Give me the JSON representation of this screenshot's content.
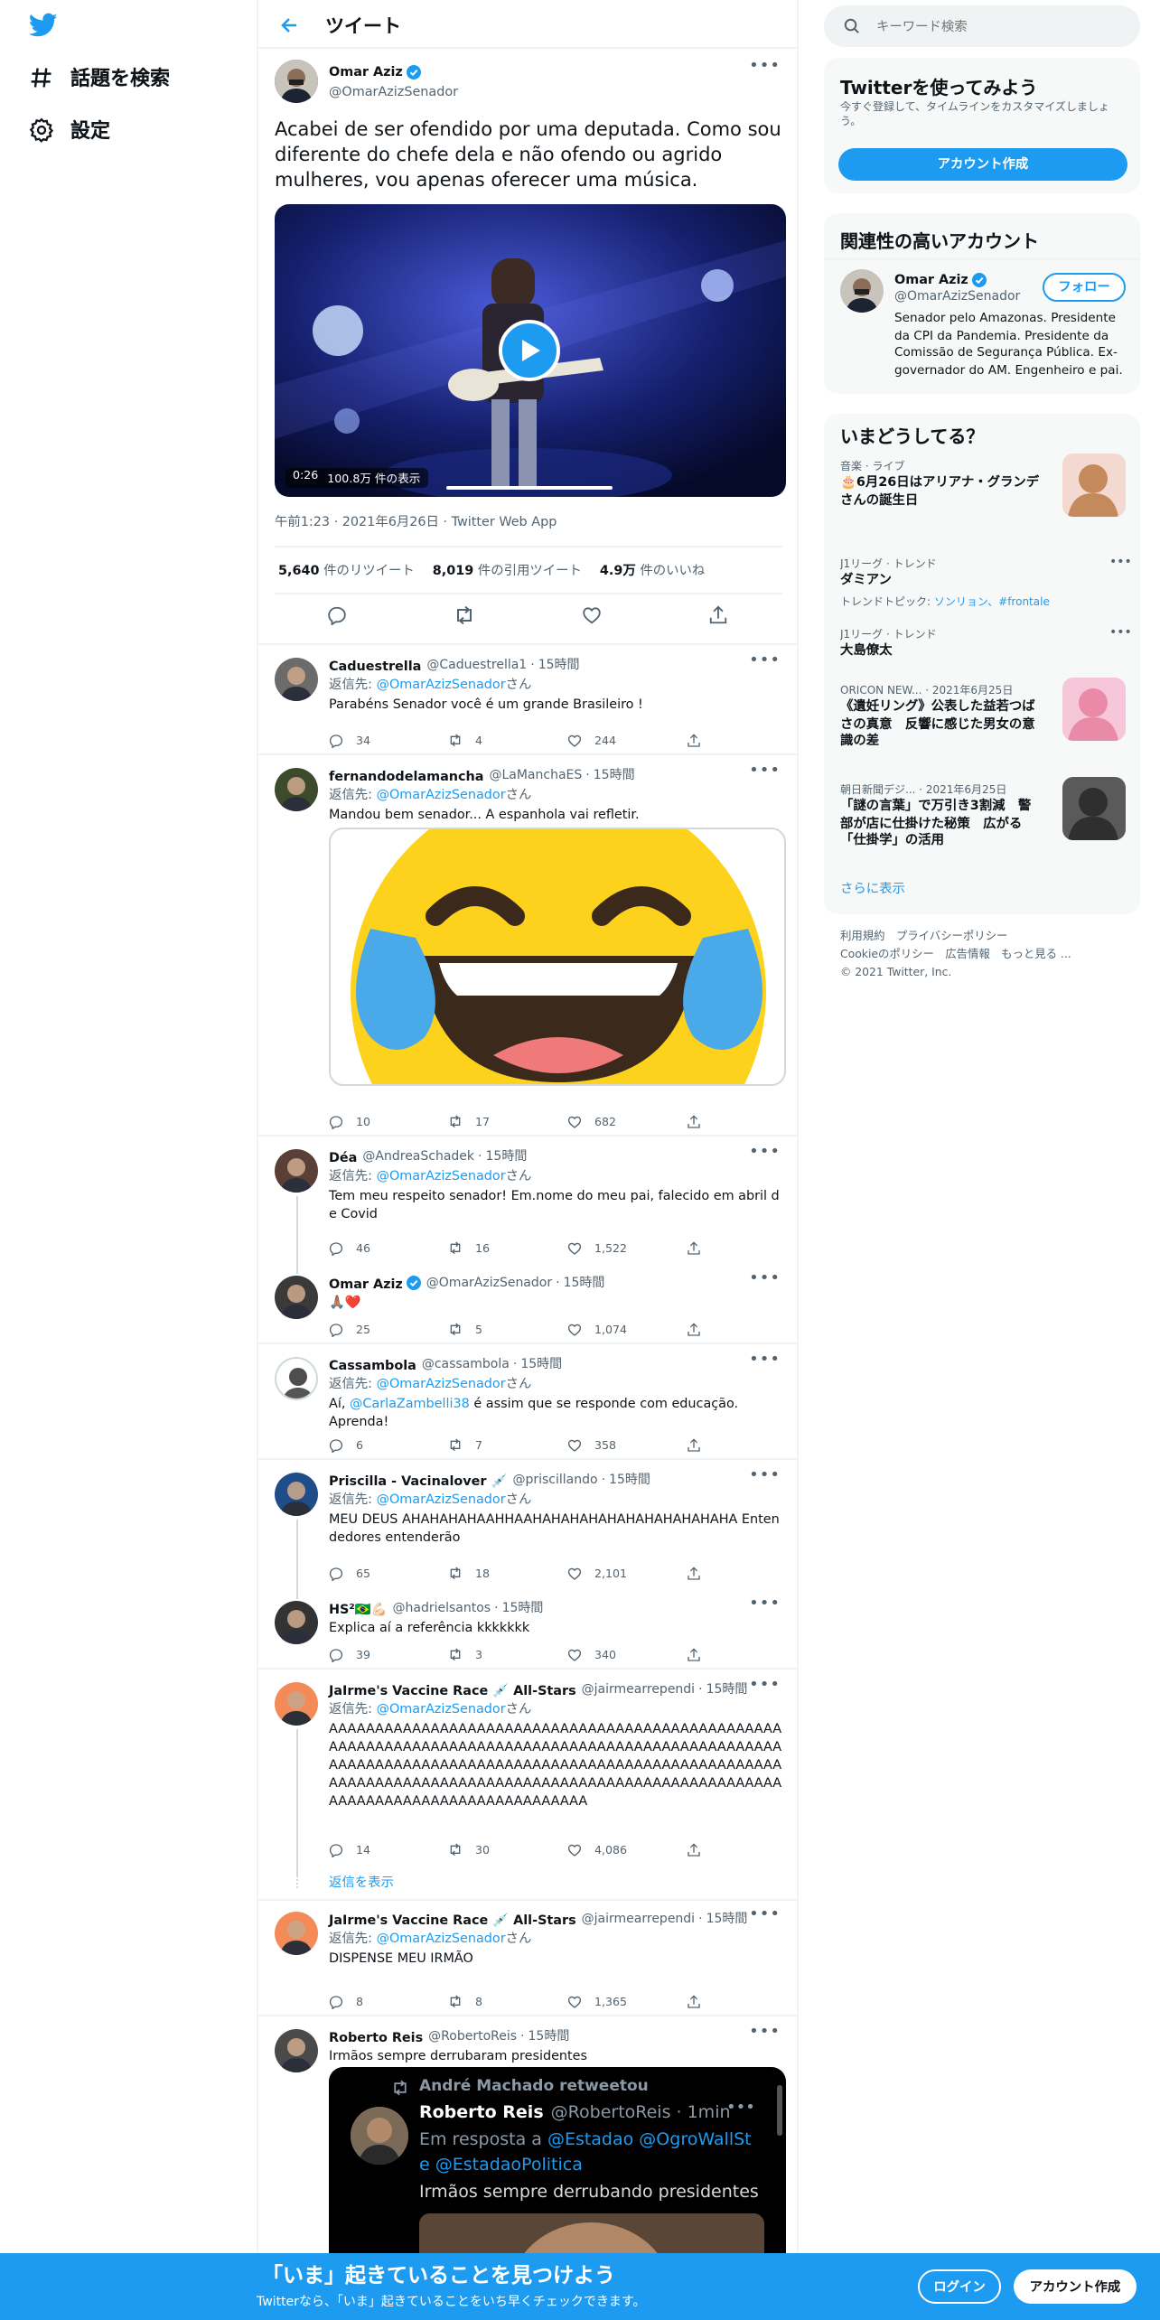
{
  "nav": {
    "explore_label": "話題を検索",
    "settings_label": "設定"
  },
  "header": {
    "title": "ツイート"
  },
  "main_tweet": {
    "name": "Omar Aziz",
    "handle": "@OmarAzizSenador",
    "text": "Acabei de ser ofendido por uma deputada. Como sou diferente do chefe dela e não ofendo ou agrido mulheres, vou apenas oferecer uma música.",
    "video_time": "0:26",
    "video_views": "100.8万 件の表示",
    "timestamp": "午前1:23 · 2021年6月26日 · Twitter Web App",
    "retweets_num": "5,640",
    "retweets_label": "件のリツイート",
    "quotes_num": "8,019",
    "quotes_label": "件の引用ツイート",
    "likes_num": "4.9万",
    "likes_label": "件のいいね"
  },
  "reply_prefix": "返信先: ",
  "reply_suffix": "さん",
  "replies": [
    {
      "name": "Caduestrella",
      "handle": "@Caduestrella1",
      "time": "15時間",
      "to": "@OmarAzizSenador",
      "text": "Parabéns Senador você é um grande Brasileiro !",
      "replies": "34",
      "retweets": "4",
      "likes": "244"
    },
    {
      "name": "fernandodelamancha",
      "handle": "@LaManchaES",
      "time": "15時間",
      "to": "@OmarAzizSenador",
      "text": "Mandou bem senador... A espanhola vai refletir.",
      "replies": "10",
      "retweets": "17",
      "likes": "682"
    },
    {
      "name": "Déa",
      "handle": "@AndreaSchadek",
      "time": "15時間",
      "to": "@OmarAzizSenador",
      "text": "Tem meu respeito senador! Em.nome do meu pai, falecido em abril de Covid",
      "replies": "46",
      "retweets": "16",
      "likes": "1,522"
    },
    {
      "name": "Omar Aziz",
      "handle": "@OmarAzizSenador",
      "time": "15時間",
      "text": "🙏🏽❤️",
      "replies": "25",
      "retweets": "5",
      "likes": "1,074"
    },
    {
      "name": "Cassambola",
      "handle": "@cassambola",
      "time": "15時間",
      "to": "@OmarAzizSenador",
      "mention": "@CarlaZambelli38",
      "text": " é assim que se responde com educação. Aprenda!",
      "text_prefix": "Aí, ",
      "replies": "6",
      "retweets": "7",
      "likes": "358"
    },
    {
      "name": "Priscilla - Vacinalover 💉",
      "handle": "@priscillando",
      "time": "15時間",
      "to": "@OmarAzizSenador",
      "text": "MEU DEUS AHAHAHAHAAHHAAHAHAHAHAHAHAHAHAHAHAHA Entendedores entenderão",
      "replies": "65",
      "retweets": "18",
      "likes": "2,101"
    },
    {
      "name": "HS²🇧🇷💪🏻",
      "handle": "@hadrielsantos",
      "time": "15時間",
      "text": "Explica aí a referência kkkkkkk",
      "replies": "39",
      "retweets": "3",
      "likes": "340"
    },
    {
      "name": "JaIrme's Vaccine Race 💉 All-Stars",
      "handle": "@jairmearrependi",
      "time": "15時間",
      "to": "@OmarAzizSenador",
      "text": "AAAAAAAAAAAAAAAAAAAAAAAAAAAAAAAAAAAAAAAAAAAAAAAAAAAAAAAAAAAAAAAAAAAAAAAAAAAAAAAAAAAAAAAAAAAAAAAAAAAAAAAAAAAAAAAAAAAAAAAAAAAAAAAAAAAAAAAAAAAAAAAAAAAAAAAAAAAAAAAAAAAAAAAAAAAAAAAAAAAAAAAAAAAAAAAAAAAAAAAAAAAAAAAAAAAAAAAAAAAAAAAA",
      "replies": "14",
      "retweets": "30",
      "likes": "4,086"
    },
    {
      "name": "JaIrme's Vaccine Race 💉 All-Stars",
      "handle": "@jairmearrependi",
      "time": "15時間",
      "to": "@OmarAzizSenador",
      "text": "DISPENSE MEU IRMÃO",
      "replies": "8",
      "retweets": "8",
      "likes": "1,365"
    },
    {
      "name": "Roberto Reis",
      "handle": "@RobertoReis",
      "time": "15時間",
      "text": "Irmãos sempre derrubaram presidentes"
    }
  ],
  "show_replies": "返信を表示",
  "embedded": {
    "retweeted_by": "André Machado retweetou",
    "name": "Roberto Reis",
    "handle": "@RobertoReis · 1min",
    "reply_prefix": "Em resposta a ",
    "mentions": "@Estadao @OgroWallSt e @EstadaoPolitica",
    "text": "Irmãos sempre derrubando presidentes"
  },
  "search": {
    "placeholder": "キーワード検索"
  },
  "signup": {
    "title": "Twitterを使ってみよう",
    "sub": "今すぐ登録して、タイムラインをカスタマイズしましょう。",
    "button": "アカウント作成"
  },
  "related": {
    "title": "関連性の高いアカウント",
    "name": "Omar Aziz",
    "handle": "@OmarAzizSenador",
    "follow": "フォロー",
    "bio": "Senador pelo Amazonas. Presidente da CPI da Pandemia. Presidente da Comissão de Segurança Pública. Ex-governador do AM. Engenheiro e pai."
  },
  "trends": {
    "title": "いまどうしてる？",
    "items": [
      {
        "cat": "音楽 · ライブ",
        "title": "🎂6月26日はアリアナ・グランデさんの誕生日"
      },
      {
        "cat": "J1リーグ · トレンド",
        "title": "ダミアン",
        "topics_label": "トレンドトピック: ",
        "topics": "ソンリョン、#frontale"
      },
      {
        "cat": "J1リーグ · トレンド",
        "title": "大島僚太"
      },
      {
        "cat": "ORICON NEW... · 2021年6月25日",
        "title": "《遺妊リング》公表した益若つばさの真意　反響に感じた男女の意識の差"
      },
      {
        "cat": "朝日新聞デジ... · 2021年6月25日",
        "title": "「謎の言葉」で万引き3割減　警部が店に仕掛けた秘策　広がる「仕掛学」の活用"
      }
    ],
    "more": "さらに表示"
  },
  "footer": {
    "line1": "利用規約　プライバシーポリシー",
    "line2": "Cookieのポリシー　広告情報　もっと見る ...",
    "copy": "© 2021 Twitter, Inc."
  },
  "bottom": {
    "title": "「いま」起きていることを見つけよう",
    "sub": "Twitterなら、「いま」起きていることをいち早くチェックできます。",
    "login": "ログイン",
    "signup": "アカウント作成"
  },
  "colors": {
    "accent": "#1d9bf0",
    "text": "#0f1419",
    "gray": "#536471"
  }
}
